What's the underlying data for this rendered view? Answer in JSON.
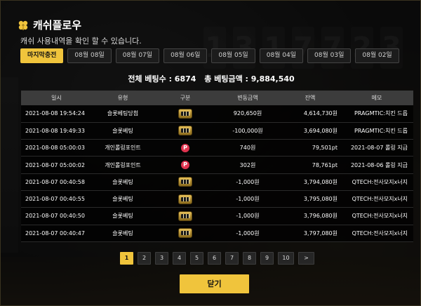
{
  "modal": {
    "title": "캐쉬플로우",
    "subtitle": "캐쉬 사용내역을 확인 할 수 있습니다.",
    "close_label": "닫기"
  },
  "tabs": [
    {
      "label": "마지막충전",
      "active": true
    },
    {
      "label": "08월 08일",
      "active": false
    },
    {
      "label": "08월 07일",
      "active": false
    },
    {
      "label": "08월 06일",
      "active": false
    },
    {
      "label": "08월 05일",
      "active": false
    },
    {
      "label": "08월 04일",
      "active": false
    },
    {
      "label": "08월 03일",
      "active": false
    },
    {
      "label": "08월 02일",
      "active": false
    }
  ],
  "summary": {
    "total_bet_label": "전체 베팅수 : 6874",
    "total_amount_label": "총 베팅금액 : 9,884,540"
  },
  "table": {
    "headers": [
      "일시",
      "유형",
      "구분",
      "변동금액",
      "잔액",
      "메모"
    ],
    "rows": [
      {
        "date": "2021-08-08 19:54:24",
        "type": "슬롯베팅당첨",
        "kind": "slot-icon",
        "change": "920,650원",
        "balance": "4,614,730원",
        "memo": "PRAGMTIC:치킨 드롭",
        "sign": "pos"
      },
      {
        "date": "2021-08-08 19:49:33",
        "type": "슬롯베팅",
        "kind": "slot-icon",
        "change": "-100,000원",
        "balance": "3,694,080원",
        "memo": "PRAGMTIC:치킨 드롭",
        "sign": "neg"
      },
      {
        "date": "2021-08-08 05:00:03",
        "type": "개인롤링포인트",
        "kind": "point-icon",
        "change": "740원",
        "balance": "79,501pt",
        "memo": "2021-08-07 롤링 지급",
        "sign": "pos"
      },
      {
        "date": "2021-08-07 05:00:02",
        "type": "개인롤링포인트",
        "kind": "point-icon",
        "change": "302원",
        "balance": "78,761pt",
        "memo": "2021-08-06 롤링 지급",
        "sign": "pos"
      },
      {
        "date": "2021-08-07 00:40:58",
        "type": "슬롯베팅",
        "kind": "slot-icon",
        "change": "-1,000원",
        "balance": "3,794,080원",
        "memo": "QTECH:전사모지x너지",
        "sign": "neg"
      },
      {
        "date": "2021-08-07 00:40:55",
        "type": "슬롯베팅",
        "kind": "slot-icon",
        "change": "-1,000원",
        "balance": "3,795,080원",
        "memo": "QTECH:전사모지x너지",
        "sign": "neg"
      },
      {
        "date": "2021-08-07 00:40:50",
        "type": "슬롯베팅",
        "kind": "slot-icon",
        "change": "-1,000원",
        "balance": "3,796,080원",
        "memo": "QTECH:전사모지x너지",
        "sign": "neg"
      },
      {
        "date": "2021-08-07 00:40:47",
        "type": "슬롯베팅",
        "kind": "slot-icon",
        "change": "-1,000원",
        "balance": "3,797,080원",
        "memo": "QTECH:전사모지x너지",
        "sign": "neg"
      }
    ],
    "point_glyph": "P"
  },
  "pagination": {
    "pages": [
      "1",
      "2",
      "3",
      "4",
      "5",
      "6",
      "7",
      "8",
      "9",
      "10"
    ],
    "current": "1",
    "next_label": ">"
  },
  "colors": {
    "accent": "#f0c43c",
    "positive": "#4aa3ff",
    "negative": "#ff3b3b"
  }
}
